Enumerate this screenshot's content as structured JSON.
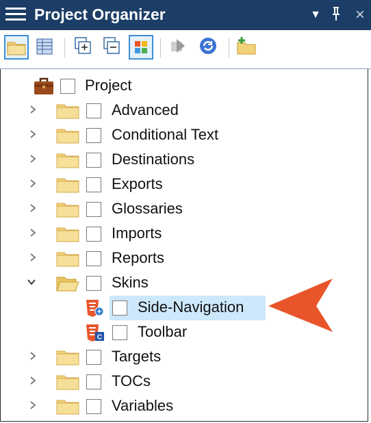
{
  "window": {
    "title": "Project Organizer",
    "menu_icon": "hamburger-icon",
    "controls": {
      "dropdown": "▼",
      "pin": "🖈",
      "close": "×"
    }
  },
  "toolbar": {
    "items": [
      {
        "name": "open-folder-icon",
        "selected": true
      },
      {
        "name": "grid-view-icon",
        "selected": false
      },
      {
        "name": "expand-all-icon",
        "selected": false
      },
      {
        "name": "collapse-all-icon",
        "selected": false
      },
      {
        "name": "show-colors-icon",
        "selected": true
      },
      {
        "name": "forward-icon",
        "selected": false,
        "disabled": true
      },
      {
        "name": "refresh-icon",
        "selected": false
      },
      {
        "name": "new-folder-icon",
        "selected": false
      }
    ]
  },
  "tree": {
    "root": {
      "label": "Project",
      "icon": "briefcase-icon"
    },
    "items": [
      {
        "label": "Advanced",
        "expanded": false
      },
      {
        "label": "Conditional Text",
        "expanded": false
      },
      {
        "label": "Destinations",
        "expanded": false
      },
      {
        "label": "Exports",
        "expanded": false
      },
      {
        "label": "Glossaries",
        "expanded": false
      },
      {
        "label": "Imports",
        "expanded": false
      },
      {
        "label": "Reports",
        "expanded": false
      },
      {
        "label": "Skins",
        "expanded": true
      },
      {
        "label": "Targets",
        "expanded": false
      },
      {
        "label": "TOCs",
        "expanded": false
      },
      {
        "label": "Variables",
        "expanded": false
      }
    ],
    "skins_children": [
      {
        "label": "Side-Navigation",
        "selected": true,
        "icon": "html5-skin-icon"
      },
      {
        "label": "Toolbar",
        "selected": false,
        "icon": "html5-css-skin-icon"
      }
    ]
  },
  "colors": {
    "titlebar": "#1b3d66",
    "selection": "#cde8fb",
    "folder": "#f1d27a",
    "arrow": "#e8552b"
  }
}
